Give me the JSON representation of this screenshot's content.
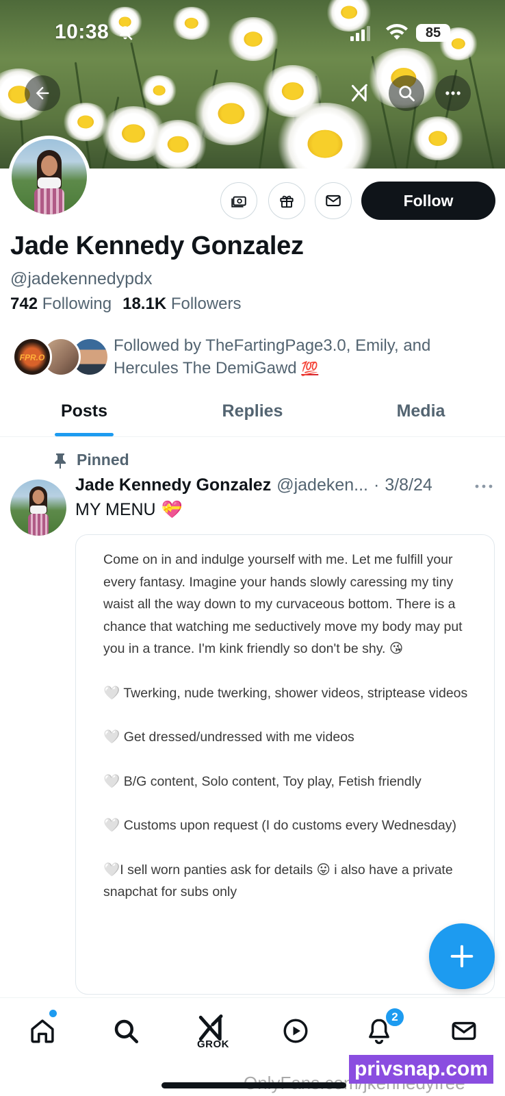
{
  "status_bar": {
    "time": "10:38",
    "battery": "85"
  },
  "profile": {
    "display_name": "Jade Kennedy Gonzalez",
    "handle": "@jadekennedypdx",
    "following_count": "742",
    "following_label": "Following",
    "followers_count": "18.1K",
    "followers_label": "Followers",
    "follow_button": "Follow",
    "followed_by_text": "Followed by TheFartingPage3.0, Emily, and Hercules The DemiGawd",
    "followed_by_emoji": "💯",
    "mini_avatar_logo": "FPR.O"
  },
  "tabs": [
    {
      "label": "Posts",
      "active": true
    },
    {
      "label": "Replies",
      "active": false
    },
    {
      "label": "Media",
      "active": false
    }
  ],
  "post": {
    "pinned_label": "Pinned",
    "author_name": "Jade Kennedy Gonzalez",
    "author_handle": "@jadeken...",
    "dot": "·",
    "date": "3/8/24",
    "text": "MY MENU",
    "text_emoji": "💝",
    "quote_paragraphs": [
      "Come on in and indulge yourself with me. Let me fulfill your every fantasy. Imagine your hands slowly caressing my tiny waist all the way down to my curvaceous bottom. There is a chance that watching me seductively move my body may put you in a trance. I'm kink friendly so don't be shy. 😘",
      "🤍 Twerking, nude twerking, shower videos, striptease videos",
      "🤍 Get dressed/undressed with me videos",
      "🤍 B/G content, Solo content, Toy play, Fetish friendly",
      "🤍 Customs upon request (I do customs every Wednesday)",
      "🤍I sell worn panties ask for details 😛 i also have a private snapchat for subs only"
    ]
  },
  "bottom_nav": {
    "grok_label": "GROK",
    "notification_count": "2"
  },
  "watermarks": {
    "gray": "OnlyFans.com/jkennedyfree",
    "purple": "privsnap.com"
  },
  "colors": {
    "accent": "#1d9bf0",
    "text_primary": "#0f1419",
    "text_secondary": "#536471",
    "follow_button_bg": "#0f1419"
  },
  "icons": [
    "back-arrow-icon",
    "grok-icon",
    "search-icon",
    "more-icon",
    "money-icon",
    "gift-icon",
    "mail-icon",
    "pin-icon",
    "plus-icon",
    "home-icon",
    "play-icon",
    "bell-icon"
  ]
}
